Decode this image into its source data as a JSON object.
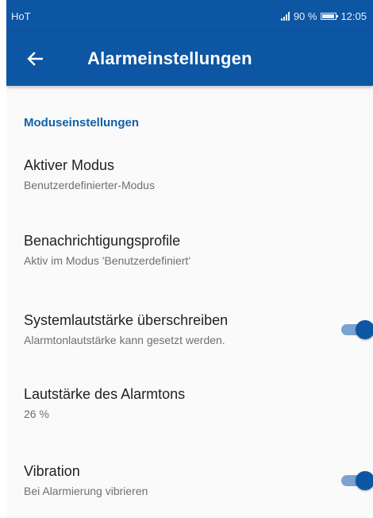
{
  "status_bar": {
    "carrier": "HoT",
    "battery": "90 %",
    "time": "12:05"
  },
  "app_bar": {
    "title": "Alarmeinstellungen",
    "back_icon": "arrow-back-icon"
  },
  "section": {
    "header": "Moduseinstellungen"
  },
  "settings": [
    {
      "title": "Aktiver Modus",
      "subtitle": "Benutzerdefinierter-Modus"
    },
    {
      "title": "Benachrichtigungsprofile",
      "subtitle": "Aktiv im Modus 'Benutzerdefiniert'"
    },
    {
      "title": "Systemlautstärke überschreiben",
      "subtitle": "Alarmtonlautstärke kann gesetzt werden.",
      "toggle": true
    },
    {
      "title": "Lautstärke des Alarmtons",
      "subtitle": "26 %"
    },
    {
      "title": "Vibration",
      "subtitle": "Bei Alarmierung vibrieren",
      "toggle": true
    }
  ],
  "colors": {
    "primary": "#0d56a3",
    "accent_text": "#1160aa",
    "toggle_track": "#7aa3cf"
  }
}
